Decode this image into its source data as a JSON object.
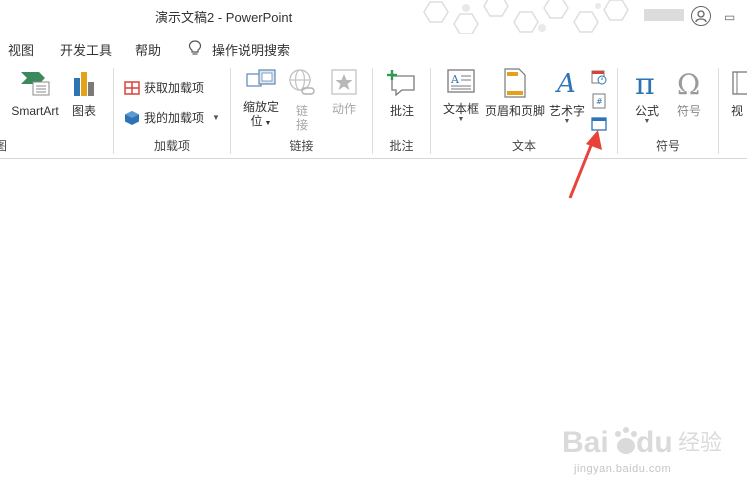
{
  "title_bar": {
    "title": "演示文稿2  -  PowerPoint"
  },
  "tabs": [
    {
      "label": "视图"
    },
    {
      "label": "开发工具"
    },
    {
      "label": "帮助"
    }
  ],
  "tell_me": {
    "label": "操作说明搜索"
  },
  "ribbon": {
    "illustrations": {
      "smartart": "SmartArt",
      "chart": "图表",
      "group_label": "图"
    },
    "addins": {
      "get_addins": "获取加载项",
      "my_addins": "我的加载项",
      "group_label": "加载项"
    },
    "links": {
      "zoom": "缩放定位",
      "zoom_line1": "缩放定",
      "zoom_line2": "位",
      "link": "链接",
      "link_line1": "链",
      "link_line2": "接",
      "action": "动作",
      "group_label": "链接"
    },
    "comments": {
      "comment": "批注",
      "group_label": "批注"
    },
    "text": {
      "textbox": "文本框",
      "header_footer": "页眉和页脚",
      "wordart": "艺术字",
      "group_label": "文本"
    },
    "symbols": {
      "equation": "公式",
      "symbol": "符号",
      "group_label": "符号"
    },
    "media": {
      "video_partial": "视"
    }
  },
  "colors": {
    "accent_red": "#d9423a",
    "icon_blue": "#2e74b5",
    "arrow_red": "#e8423a"
  },
  "watermark": {
    "brand": "Baidu经验",
    "url": "jingyan.baidu.com"
  }
}
